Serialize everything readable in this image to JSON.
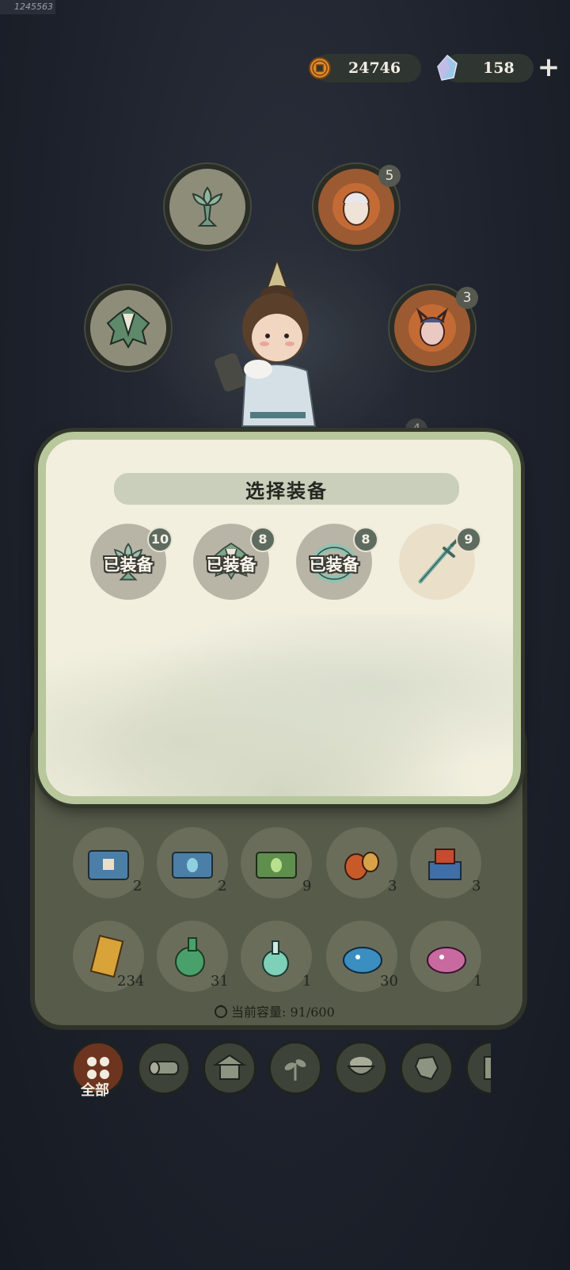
{
  "uid": "1245563",
  "currency": {
    "coins": "24746",
    "gems": "158",
    "plus": "+"
  },
  "slots": [
    {
      "name": "lotus-cup",
      "badge": ""
    },
    {
      "name": "spirit-portrait",
      "badge": "5"
    },
    {
      "name": "leaf-armor",
      "badge": ""
    },
    {
      "name": "demon-portrait",
      "badge": "3"
    },
    {
      "name": "hidden-slot",
      "badge": "4"
    }
  ],
  "dialog": {
    "title": "选择装备",
    "items": [
      {
        "icon": "lotus-cup-icon",
        "level": "10",
        "tag": "已装备"
      },
      {
        "icon": "leaf-armor-icon",
        "level": "8",
        "tag": "已装备"
      },
      {
        "icon": "jade-ring-icon",
        "level": "8",
        "tag": "已装备"
      },
      {
        "icon": "jade-sword-icon",
        "level": "9",
        "tag": ""
      }
    ]
  },
  "inventory": {
    "row1": [
      {
        "icon": "blue-chest-icon",
        "count": "2"
      },
      {
        "icon": "blue-gourd-chest-icon",
        "count": "2"
      },
      {
        "icon": "green-gourd-chest-icon",
        "count": "9"
      },
      {
        "icon": "gourd-bundle-icon",
        "count": "3"
      },
      {
        "icon": "gift-pile-icon",
        "count": "3"
      }
    ],
    "row2": [
      {
        "icon": "scroll-icon",
        "count": "234"
      },
      {
        "icon": "green-potion-icon",
        "count": "31"
      },
      {
        "icon": "flask-icon",
        "count": "1"
      },
      {
        "icon": "blue-beast-icon",
        "count": "30"
      },
      {
        "icon": "pink-beast-icon",
        "count": "1"
      }
    ],
    "capacity": "当前容量: 91/600"
  },
  "categories": {
    "all_label": "全部",
    "items": [
      "all-icon",
      "wood-icon",
      "house-icon",
      "herb-icon",
      "food-bowl-icon",
      "ore-icon",
      "scroll-tab-icon"
    ]
  },
  "colors": {
    "dialog_border": "#b9c79c",
    "dialog_bg": "#f2efdf",
    "active_category": "#6d3520"
  }
}
